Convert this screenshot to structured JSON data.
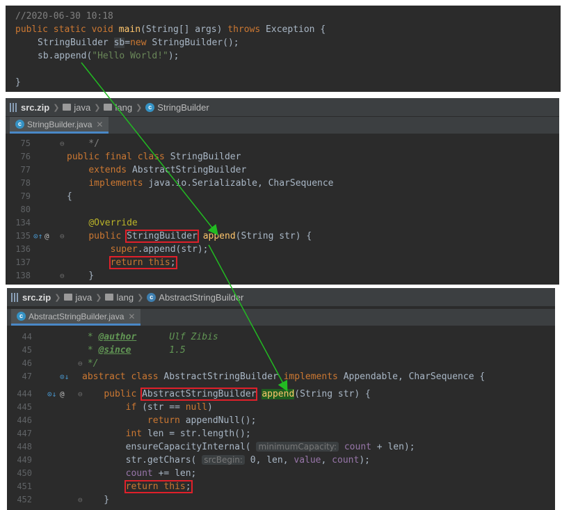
{
  "top": {
    "l0": "//2020-06-30 10:18",
    "l1": {
      "kw1": "public static void ",
      "fn": "main",
      "rest": "(String[] args) ",
      "kw2": "throws",
      "rest2": " Exception {"
    },
    "l2": {
      "a": "StringBuilder ",
      "b": "sb",
      "c": "=",
      "kw": "new",
      "d": " StringBuilder();"
    },
    "l3": {
      "a": "sb.append(",
      "str": "\"Hello World!\"",
      "b": ");"
    },
    "l4": "}"
  },
  "panel2": {
    "breadcrumb": {
      "zip": "src.zip",
      "p1": "java",
      "p2": "lang",
      "cls": "StringBuilder"
    },
    "tab": "StringBuilder.java",
    "lines": [
      {
        "n": "75",
        "t": "    */"
      },
      {
        "n": "76",
        "t": "public final class StringBuilder"
      },
      {
        "n": "77",
        "t": "    extends AbstractStringBuilder"
      },
      {
        "n": "78",
        "t": "    implements java.io.Serializable, CharSequence"
      },
      {
        "n": "79",
        "t": "{"
      },
      {
        "n": "80",
        "t": ""
      },
      {
        "n": "134",
        "t": "    @Override"
      },
      {
        "n": "135",
        "t": "    public StringBuilder append(String str) {"
      },
      {
        "n": "136",
        "t": "        super.append(str);"
      },
      {
        "n": "137",
        "t": "        return this;"
      },
      {
        "n": "138",
        "t": "    }"
      }
    ]
  },
  "panel3": {
    "breadcrumb": {
      "zip": "src.zip",
      "p1": "java",
      "p2": "lang",
      "cls": "AbstractStringBuilder"
    },
    "tab": "AbstractStringBuilder.java",
    "lines": [
      {
        "n": "44",
        "t": " * @author      Ulf Zibis"
      },
      {
        "n": "45",
        "t": " * @since       1.5"
      },
      {
        "n": "46",
        "t": " */"
      },
      {
        "n": "47",
        "t": "abstract class AbstractStringBuilder implements Appendable, CharSequence {"
      },
      {
        "n": "444",
        "t": "    public AbstractStringBuilder append(String str) {"
      },
      {
        "n": "445",
        "t": "        if (str == null)"
      },
      {
        "n": "446",
        "t": "            return appendNull();"
      },
      {
        "n": "447",
        "t": "        int len = str.length();"
      },
      {
        "n": "448",
        "t": "        ensureCapacityInternal( minimumCapacity: count + len);"
      },
      {
        "n": "449",
        "t": "        str.getChars( srcBegin: 0, len, value, count);"
      },
      {
        "n": "450",
        "t": "        count += len;"
      },
      {
        "n": "451",
        "t": "        return this;"
      },
      {
        "n": "452",
        "t": "    }"
      }
    ],
    "hints": {
      "h1": "minimumCapacity:",
      "h2": "srcBegin:"
    }
  },
  "colors": {
    "arrow": "#22bb22",
    "box": "#e0202a"
  }
}
